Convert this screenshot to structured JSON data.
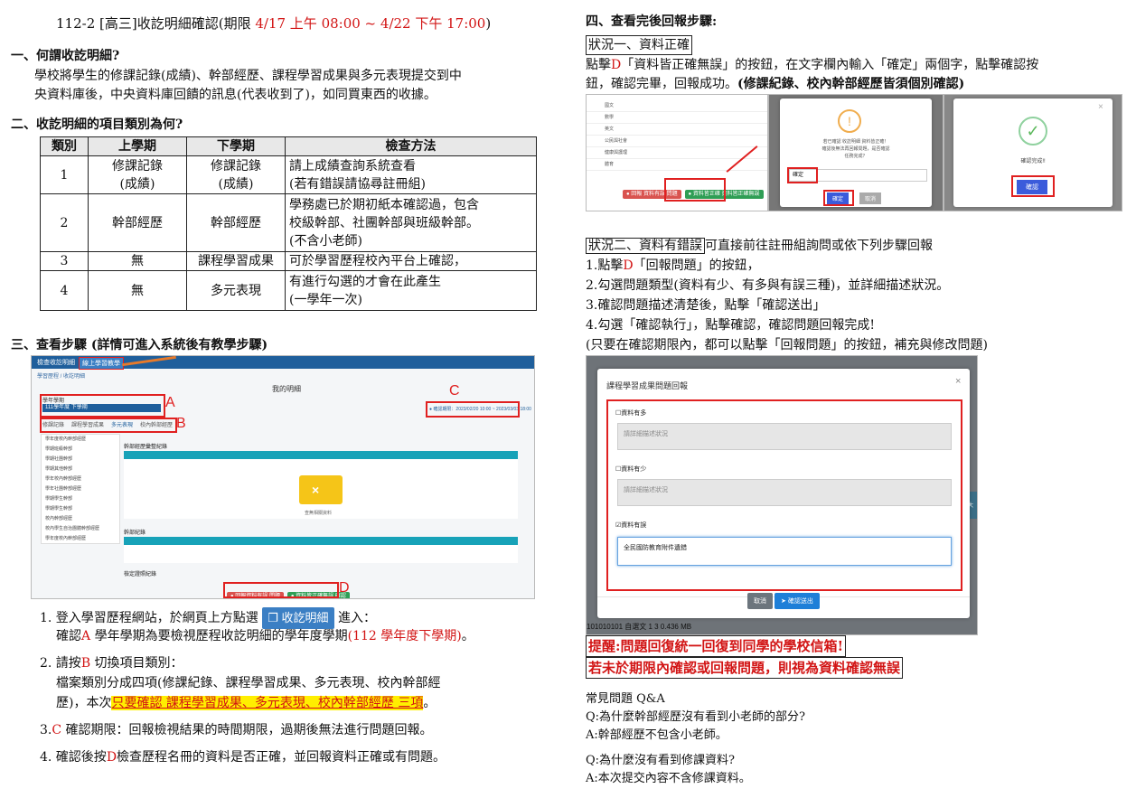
{
  "title": {
    "prefix": "112-2 [高三]收訖明細確認(期限 ",
    "range": "4/17 上午 08:00 ~ 4/22 下午 17:00",
    "suffix": ")"
  },
  "s1": {
    "heading": "一、何謂收訖明細?",
    "l1": "學校將學生的修課記錄(成績)、幹部經歷、課程學習成果與多元表現提交到中",
    "l2": "央資料庫後，中央資料庫回饋的訊息(代表收到了)，如同買東西的收據。"
  },
  "s2": {
    "heading": "二、收訖明細的項目類別為何?",
    "headers": [
      "類別",
      "上學期",
      "下學期",
      "檢查方法"
    ],
    "r1": {
      "n": "1",
      "a1": "修課記錄",
      "a2": "(成績)",
      "b1": "修課記錄",
      "b2": "(成績)",
      "c1": "請上成績查詢系統查看",
      "c2": "(若有錯誤請協尋註冊組)"
    },
    "r2": {
      "n": "2",
      "a": "幹部經歷",
      "b": "幹部經歷",
      "c1": "學務處已於期初紙本確認過，包含",
      "c2": "校級幹部、社團幹部與班級幹部。",
      "c3": "(不含小老師)"
    },
    "r3": {
      "n": "3",
      "a": "無",
      "b": "課程學習成果",
      "c": "可於學習歷程校內平台上確認，"
    },
    "r4": {
      "n": "4",
      "a": "無",
      "b": "多元表現",
      "c1": "有進行勾選的才會在此產生",
      "c2": "(一學年一次)"
    }
  },
  "s3": {
    "heading": "三、查看步驟 (詳情可進入系統後有教學步驟)",
    "shot": {
      "tab1": "檢查收訖明細",
      "tab2": "線上學習教學",
      "breadcrumb": "學習歷程 / 收訖明細",
      "main_title": "我的明細",
      "year_label": "學年學期",
      "year_value": "111學年度 下學期",
      "period": "● 確認期限：2023/02/20 10:00 ~ 2023/03/03 18:00",
      "tabs": [
        "修課記錄",
        "課程學習成果",
        "多元表現",
        "校內幹部經歷"
      ],
      "side": [
        "學年度校內幹部經歷",
        "學期班級幹部",
        "學期社團幹部",
        "學期其他幹部",
        "學年校內幹部經歷",
        "學年社團幹部經歷",
        "學期學生幹部",
        "學期學生幹部",
        "校內幹部經歷",
        "校內學生自治團體幹部經歷",
        "學年度校內幹部經歷"
      ],
      "panel1": "幹部經歷彙整紀錄",
      "panel2": "幹部紀錄",
      "panel3": "檢定證照紀錄",
      "empty": "查無相關資料",
      "btn_report": "● 回報資料有誤 問題",
      "btn_ok": "● 資料皆正確無誤 確認",
      "marks": [
        "A",
        "B",
        "C",
        "D"
      ]
    },
    "step1a": "1. 登入學習歷程網站，於網頁上方點選",
    "step1btn": "收訖明細",
    "step1b": "進入：",
    "step1c": "確認",
    "step1A": "A",
    "step1d": " 學年學期為要檢視歷程收訖明細的學年度學期",
    "step1e": "(112 學年度下學期)",
    "step1f": "。",
    "step2a": "2. 請按",
    "step2B": "B",
    "step2b": " 切換項目類別：",
    "step2c": "檔案類別分成四項(修課紀錄、課程學習成果、多元表現、校內幹部經",
    "step2d": "歷)，本次",
    "step2hl": "只要確認 課程學習成果、多元表現、校內幹部經歷 三項",
    "step2e": "。",
    "step3a": "3.",
    "step3C": "C",
    "step3b": " 確認期限：回報檢視結果的時間期限，過期後無法進行問題回報。",
    "step4a": "4. 確認後按",
    "step4D": "D",
    "step4b": "檢查歷程名冊的資料是否正確，並回報資料正確或有問題。"
  },
  "s4": {
    "heading": "四、查看完後回報步驟:",
    "case1": "狀況一、資料正確",
    "c1a": "點擊",
    "c1D": "D",
    "c1b": "「資料皆正確無誤」的按鈕，在文字欄內輸入「確定」兩個字，點擊確認按",
    "c1c": "鈕，確認完畢，回報成功。",
    "c1d": "(修課紀錄、校內幹部經歷皆須個別確認)",
    "shot1": {
      "rows": [
        "國文",
        "數學",
        "英文",
        "公民與社會",
        "健康與護理",
        "體育"
      ],
      "btn_report": "● 回報 資料有誤 問題",
      "btn_ok": "● 資料皆正確 資料皆正確無誤"
    },
    "shot2": {
      "msg1": "若已確認 收訖明細 資料皆正確！",
      "msg2": "確認後無法再回報問題，是否確認",
      "msg3": "任務完成？",
      "input_label": "確定",
      "ok": "確定",
      "cancel": "取消"
    },
    "shot3": {
      "msg": "確認完成!!",
      "ok": "確認",
      "close": "×"
    },
    "case2": "狀況二、資料有錯誤",
    "case2b": "可直接前往註冊組詢問或依下列步驟回報",
    "c2l1a": "1.點擊",
    "c2D": "D",
    "c2l1b": "「回報問題」的按鈕，",
    "c2l2": "2.勾選問題類型(資料有少、有多與有誤三種)，並詳細描述狀況。",
    "c2l3": "3.確認問題描述清楚後，點擊「確認送出」",
    "c2l4": "4.勾選「確認執行」，點擊確認，確認問題回報完成!",
    "c2l5": "(只要在確認期限內，都可以點擊「回報問題」的按鈕，補充與修改問題)",
    "modal": {
      "title": "課程學習成果問題回報",
      "close": "×",
      "opt1": "資料有多",
      "opt2": "資料有少",
      "opt3": "資料有誤",
      "placeholder": "請詳細描述狀況",
      "value": "全民國防教育附件遺錯",
      "cancel": "取消",
      "submit": "確認送出",
      "bg_text": "檔案大小",
      "bg_row": "101010101  自選文  1  3  0.436 MB"
    },
    "remind1": "提醒:問題回復統一回復到同學的學校信箱!",
    "remind2": "若未於期限內確認或回報問題，則視為資料確認無誤",
    "faq_title": "常見問題 Q&A",
    "q1": "Q:為什麼幹部經歷沒有看到小老師的部分?",
    "a1": "A:幹部經歷不包含小老師。",
    "q2": "Q:為什麼沒有看到修課資料?",
    "a2": "A:本次提交內容不含修課資料。"
  }
}
